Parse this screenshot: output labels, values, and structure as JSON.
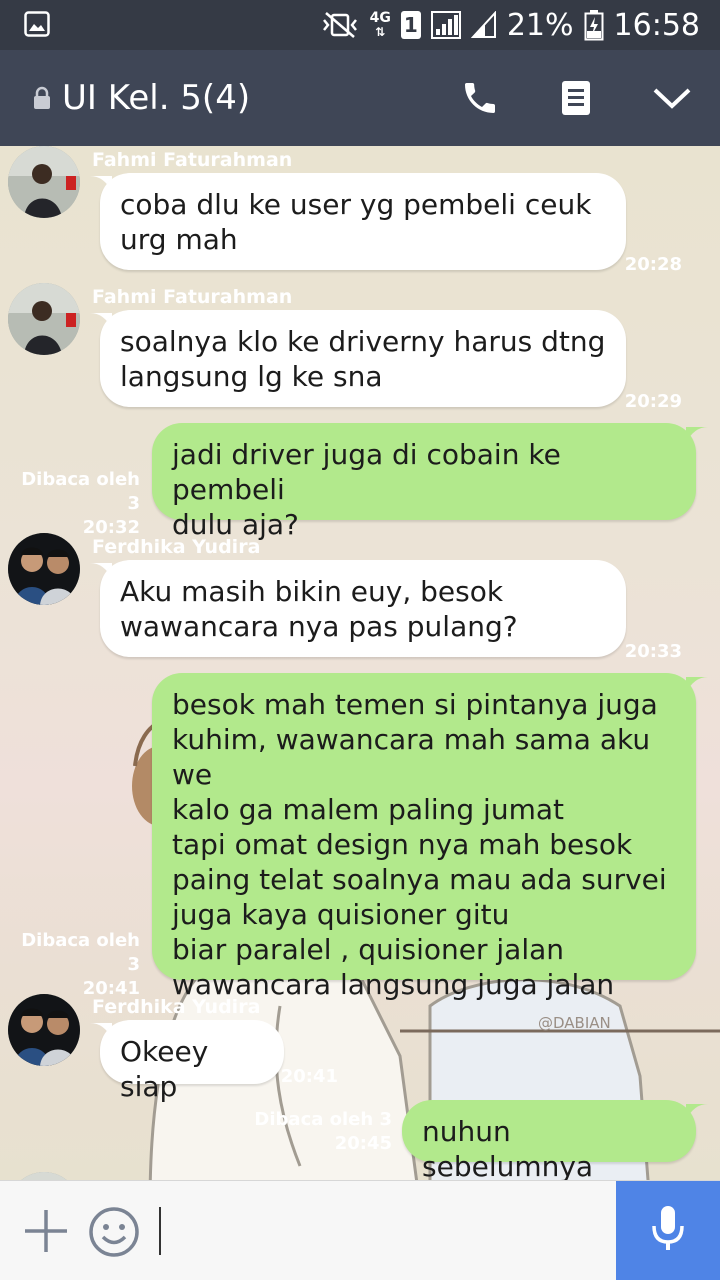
{
  "status_bar": {
    "battery_percent": "21%",
    "time": "16:58",
    "network": "4G",
    "sim": "1"
  },
  "header": {
    "title": "UI Kel. 5(4)",
    "icons": [
      "lock-icon",
      "phone-icon",
      "note-icon",
      "chevron-down-icon"
    ]
  },
  "messages": [
    {
      "direction": "in",
      "sender": "Fahmi Faturahman",
      "text": "coba dlu ke user yg pembeli ceuk\nurg mah",
      "time": "20:28"
    },
    {
      "direction": "in",
      "sender": "Fahmi Faturahman",
      "text": "soalnya klo ke driverny harus dtng\nlangsung lg ke sna",
      "time": "20:29"
    },
    {
      "direction": "out",
      "read": "Dibaca oleh 3",
      "text": "jadi driver juga di cobain ke pembeli\ndulu aja?",
      "time": "20:32"
    },
    {
      "direction": "in",
      "sender": "Ferdhika Yudira",
      "text": "Aku masih bikin euy, besok\nwawancara nya pas pulang?",
      "time": "20:33"
    },
    {
      "direction": "out",
      "read": "Dibaca oleh 3",
      "text": "besok mah temen si pintanya juga\nkuhim, wawancara mah sama aku we\nkalo ga malem paling jumat\ntapi omat design nya mah besok\npaing telat soalnya mau ada survei\njuga kaya quisioner gitu\nbiar paralel , quisioner jalan\nwawancara langsung juga jalan",
      "time": "20:41"
    },
    {
      "direction": "in",
      "sender": "Ferdhika Yudira",
      "text": "Okeey siap",
      "time": "20:41"
    },
    {
      "direction": "out",
      "read": "Dibaca oleh 3",
      "text": "nuhun sebelumnya",
      "time": "20:45"
    }
  ],
  "watermark": "@DABIAN",
  "input": {
    "placeholder": ""
  },
  "colors": {
    "status_bar": "#353a45",
    "header": "#3f4656",
    "bubble_out": "#b2e98c",
    "bubble_in": "#ffffff",
    "mic_button": "#4f84e6"
  }
}
